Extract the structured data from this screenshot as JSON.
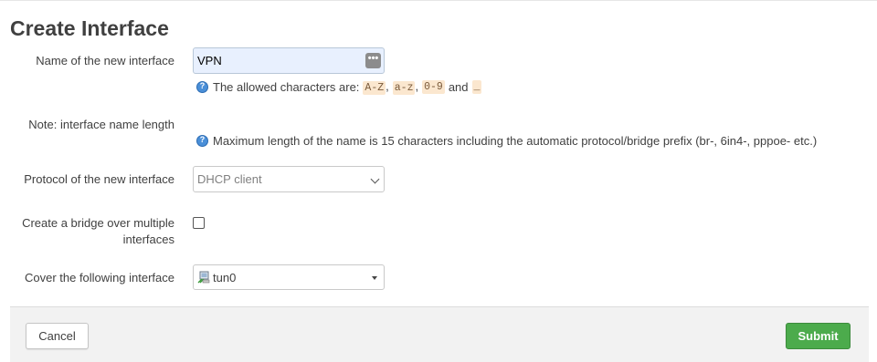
{
  "page": {
    "title": "Create Interface"
  },
  "name_row": {
    "label": "Name of the new interface",
    "value": "VPN",
    "hint_prefix": "The allowed characters are:",
    "chars": [
      "A-Z",
      "a-z",
      "0-9",
      "_"
    ],
    "sep": ",",
    "and_word": "and"
  },
  "note_row": {
    "label": "Note: interface name length",
    "hint": "Maximum length of the name is 15 characters including the automatic protocol/bridge prefix (br-, 6in4-, pppoe- etc.)"
  },
  "protocol_row": {
    "label": "Protocol of the new interface",
    "selected": "DHCP client"
  },
  "bridge_row": {
    "label_line1": "Create a bridge over multiple",
    "label_line2": "interfaces",
    "checked": false
  },
  "cover_row": {
    "label": "Cover the following interface",
    "selected": "tun0",
    "icon": "network-interface-icon"
  },
  "footer": {
    "cancel_label": "Cancel",
    "submit_label": "Submit"
  },
  "colors": {
    "submit_bg": "#4cab4c",
    "input_bg": "#e8f0fe",
    "code_bg": "#fbe7cf",
    "info_icon": "#4a8fd8"
  }
}
